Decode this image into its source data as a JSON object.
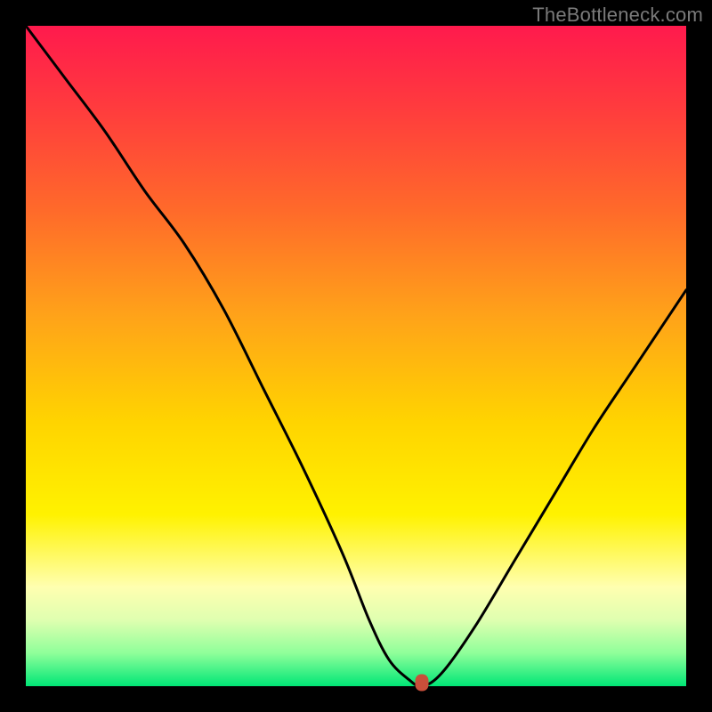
{
  "attribution": "TheBottleneck.com",
  "chart_data": {
    "type": "line",
    "title": "",
    "xlabel": "",
    "ylabel": "",
    "xlim": [
      0,
      100
    ],
    "ylim": [
      0,
      100
    ],
    "series": [
      {
        "name": "bottleneck-curve",
        "x": [
          0,
          6,
          12,
          18,
          24,
          30,
          36,
          42,
          48,
          52,
          55,
          58,
          60,
          63,
          68,
          74,
          80,
          86,
          92,
          100
        ],
        "y": [
          100,
          92,
          84,
          75,
          67,
          57,
          45,
          33,
          20,
          10,
          4,
          1,
          0,
          2,
          9,
          19,
          29,
          39,
          48,
          60
        ]
      }
    ],
    "marker": {
      "x": 60,
      "y": 0.5,
      "color": "#c94f3a"
    },
    "gradient_stops": [
      {
        "pos": 0,
        "color": "#ff1a4d"
      },
      {
        "pos": 12,
        "color": "#ff3a3e"
      },
      {
        "pos": 28,
        "color": "#ff6a2a"
      },
      {
        "pos": 44,
        "color": "#ffa319"
      },
      {
        "pos": 60,
        "color": "#ffd400"
      },
      {
        "pos": 74,
        "color": "#fff200"
      },
      {
        "pos": 85,
        "color": "#ffffb0"
      },
      {
        "pos": 90,
        "color": "#dfffb0"
      },
      {
        "pos": 95,
        "color": "#8fff9a"
      },
      {
        "pos": 100,
        "color": "#00e676"
      }
    ]
  }
}
